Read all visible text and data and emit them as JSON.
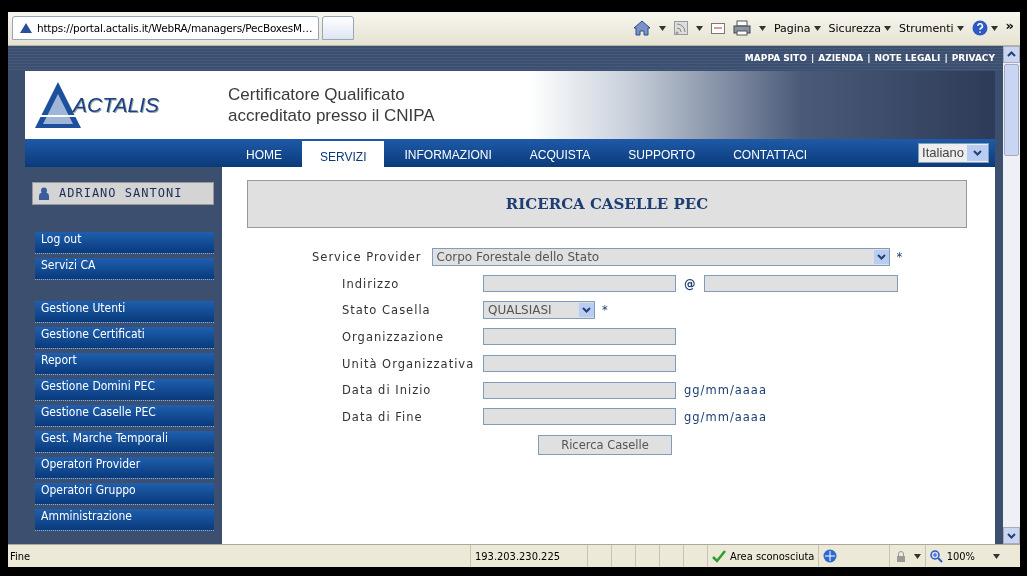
{
  "browser": {
    "tab_title": "https://portal.actalis.it/WebRA/managers/PecBoxesM…",
    "menus": [
      "Pagina",
      "Sicurezza",
      "Strumenti"
    ],
    "chevron": "»"
  },
  "site": {
    "top_links": [
      "MAPPA SITO",
      "AZIENDA",
      "NOTE LEGALI",
      "PRIVACY"
    ],
    "separator": "|",
    "logo_text": "ACTALIS",
    "tagline": [
      "Certificatore Qualificato",
      "accreditato presso il CNIPA"
    ],
    "language": "Italiano"
  },
  "nav": [
    {
      "label": "HOME",
      "selected": false
    },
    {
      "label": "SERVIZI",
      "selected": true
    },
    {
      "label": "INFORMAZIONI",
      "selected": false
    },
    {
      "label": "ACQUISTA",
      "selected": false
    },
    {
      "label": "SUPPORTO",
      "selected": false
    },
    {
      "label": "CONTATTACI",
      "selected": false
    }
  ],
  "user": {
    "name": "ADRIANO SANTONI"
  },
  "sidebar": {
    "groups": [
      [
        "Log out",
        "Servizi CA"
      ],
      [
        "Gestione Utenti",
        "Gestione Certificati",
        "Report",
        "Gestione Domini PEC",
        "Gestione Caselle PEC",
        "Gest. Marche Temporali",
        "Operatori Provider",
        "Operatori Gruppo",
        "Amministrazione"
      ]
    ]
  },
  "form": {
    "title": "RICERCA CASELLE PEC",
    "required_mark": "*",
    "at_sign": "@",
    "fields": [
      {
        "kind": "provider",
        "label": "Service Provider",
        "value": "Corpo Forestale dello Stato",
        "required": true
      },
      {
        "kind": "email",
        "label": "Indirizzo",
        "required": false
      },
      {
        "kind": "status",
        "label": "Stato Casella",
        "value": "QUALSIASI",
        "required": true
      },
      {
        "kind": "text",
        "label": "Organizzazione",
        "required": false
      },
      {
        "kind": "text",
        "label": "Unità Organizzativa",
        "required": false
      },
      {
        "kind": "date",
        "label": "Data di Inizio",
        "hint": "gg/mm/aaaa",
        "required": false
      },
      {
        "kind": "date",
        "label": "Data di Fine",
        "hint": "gg/mm/aaaa",
        "required": false
      }
    ],
    "button": "Ricerca Caselle"
  },
  "status_bar": {
    "text": "Fine",
    "ip": "193.203.230.225",
    "zone": "Area sconosciuta",
    "zoom": "100%"
  }
}
